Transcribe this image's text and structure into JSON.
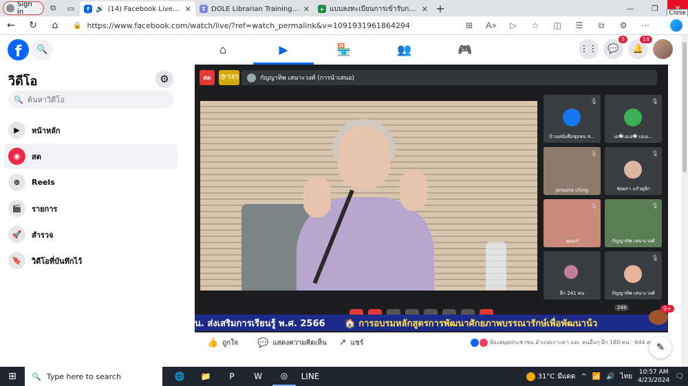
{
  "browser": {
    "signin_label": "Sign in",
    "tabs": [
      {
        "title": "(14) Facebook Live | Facebook",
        "active": true
      },
      {
        "title": "DOLE Librarian Training - อบรมบรรณารักษ์",
        "active": false
      },
      {
        "title": "แบบลงทะเบียนการเข้ารับการอบรม (การขอบ",
        "active": false
      }
    ],
    "close_tooltip": "Close",
    "url": "https://www.facebook.com/watch/live/?ref=watch_permalink&v=1091931961864294"
  },
  "header": {
    "messenger_badge": "3",
    "notifications_badge": "14"
  },
  "sidebar": {
    "title": "วิดีโอ",
    "search_placeholder": "ค้นหาวิดีโอ",
    "items": [
      {
        "label": "หน้าหลัก",
        "icon": "play-icon"
      },
      {
        "label": "สด",
        "icon": "live-icon"
      },
      {
        "label": "Reels",
        "icon": "reels-icon"
      },
      {
        "label": "รายการ",
        "icon": "clapper-icon"
      },
      {
        "label": "สำรวจ",
        "icon": "rocket-icon"
      },
      {
        "label": "วิดีโอที่บันทึกไว้",
        "icon": "bookmark-icon"
      }
    ]
  },
  "video": {
    "live_label": "สด",
    "viewer_count": "585",
    "host_name": "กัญญาทิพ เสนาะวงศ์ (การนำเสนอ)",
    "participants": [
      {
        "name": "บ้านหนังสือชุมชน ส..."
      },
      {
        "name": "เอ�เอเอ�.เอเอ..."
      },
      {
        "name": "prisana ching"
      },
      {
        "name": "ช่อผกา แก้วผุสิก"
      },
      {
        "name": "คุณเก๋"
      },
      {
        "name": "กัญญาทิพ เสนาะวงศ์"
      },
      {
        "name": "อีก 241 คน"
      },
      {
        "name": "กัญญาทิพ เสนาะวงศ์"
      }
    ],
    "ticker_left": "น. ส่งเสริมการเรียนรู้ พ.ศ. 2566",
    "ticker_right": "🏠 การอบรมหลักสูตรการพัฒนาศักยภาพบรรณารักษ์เพื่อพัฒนาน้ว",
    "count_badge": "249",
    "chat_badge": "9+"
  },
  "actions": {
    "like": "ถูกใจ",
    "comment": "แสดงความคิดเห็น",
    "share": "แชร์",
    "reaction_summary": "ห้องสมุดประชาชน อำเภอเกาะคา และ คนอื่นๆ อีก 180 คน · 644 ความคิ"
  },
  "taskbar": {
    "search_placeholder": "Type here to search",
    "temperature": "31°C",
    "weather": "มีแดด",
    "lang": "ไทย",
    "time": "10:57 AM",
    "date": "4/23/2024"
  }
}
